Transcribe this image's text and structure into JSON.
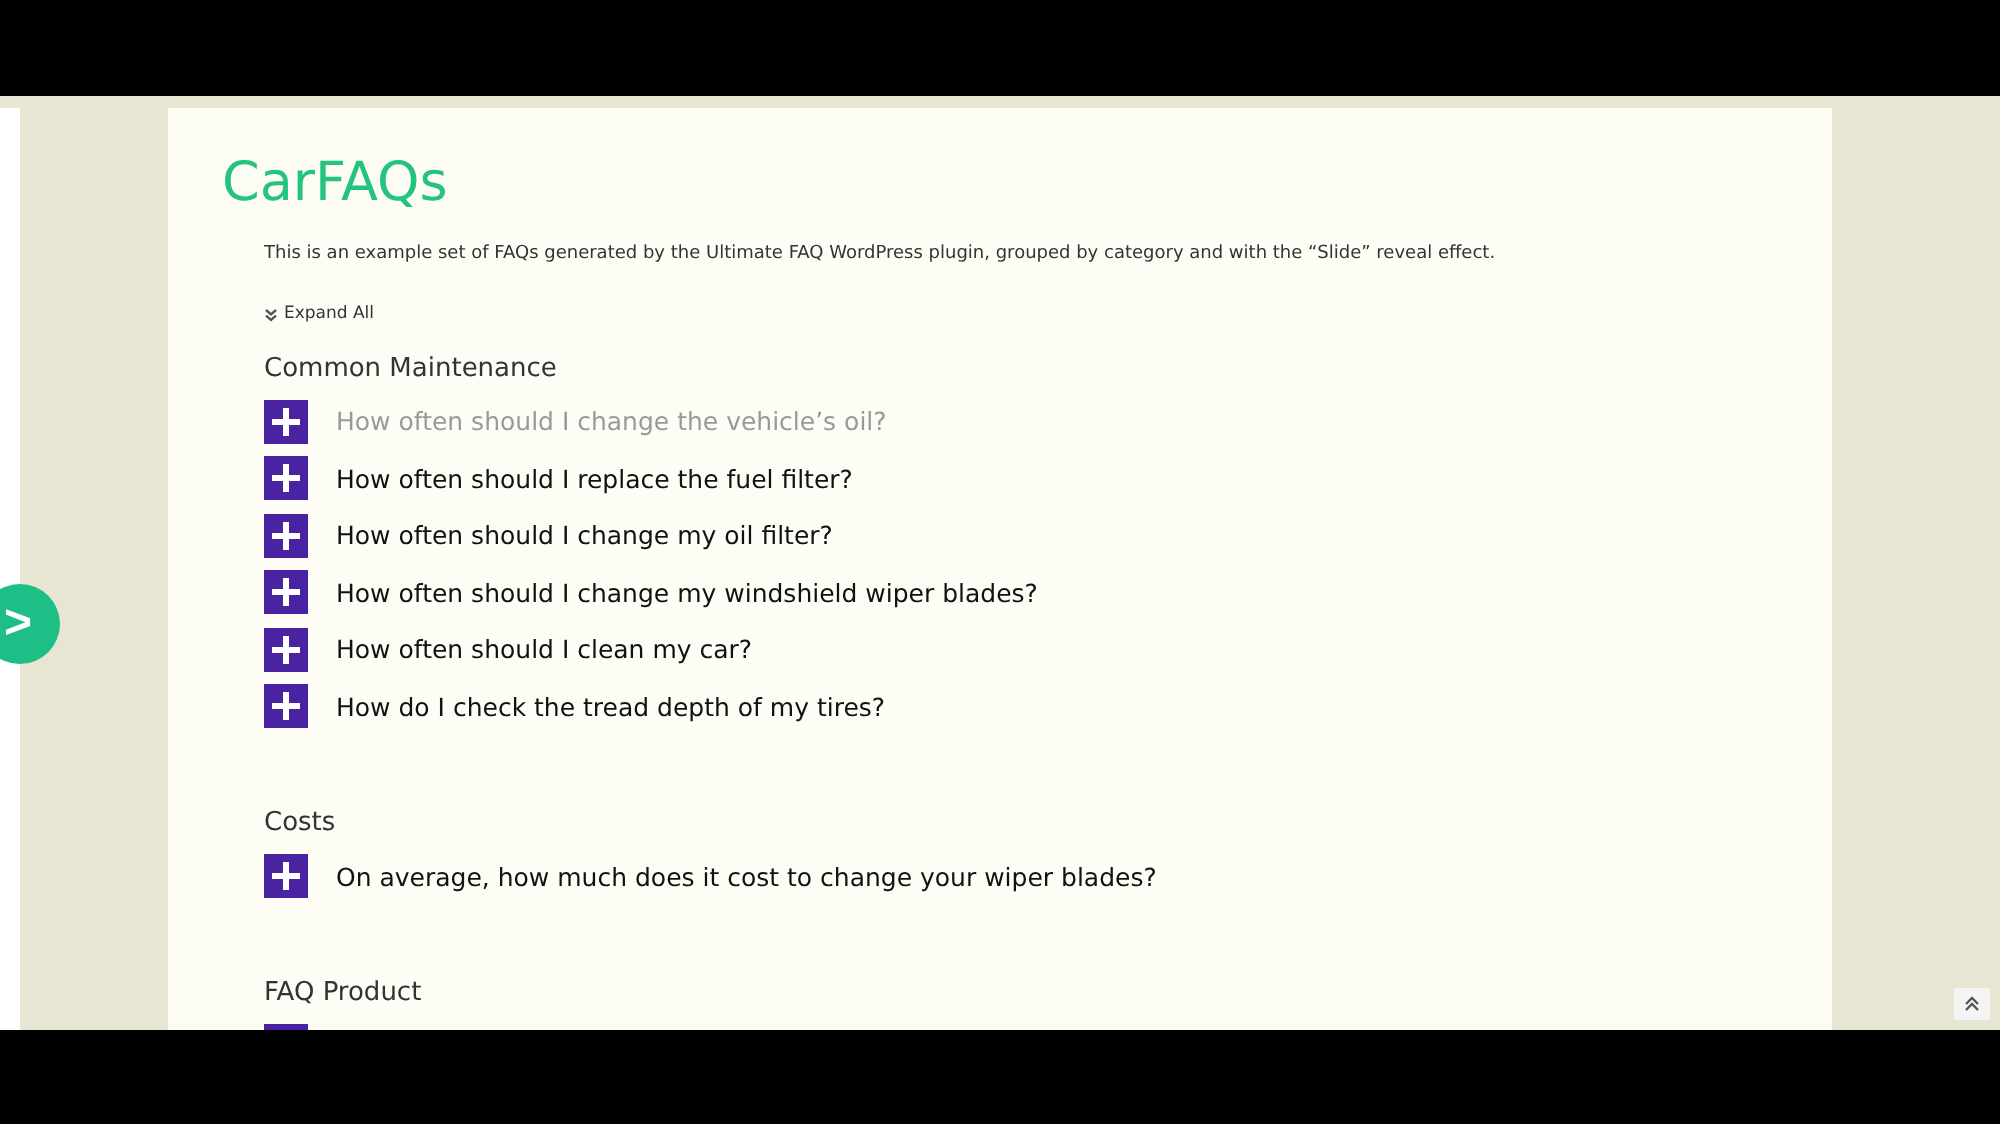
{
  "page_title": "CarFAQs",
  "description": "This is an example set of FAQs generated by the Ultimate FAQ WordPress plugin, grouped by category and with the “Slide” reveal effect.",
  "expand_all": "Expand All",
  "categories": [
    {
      "name": "Common Maintenance",
      "questions": [
        {
          "kind": "question",
          "text": "How often should I change the vehicle’s oil?",
          "hovered": true
        },
        {
          "kind": "question",
          "text": "How often should I replace the fuel filter?",
          "hovered": false
        },
        {
          "kind": "question",
          "text": "How often should I change my oil filter?",
          "hovered": false
        },
        {
          "kind": "question",
          "text": "How often should I change my windshield wiper blades?",
          "hovered": false
        },
        {
          "kind": "question",
          "text": "How often should I clean my car?",
          "hovered": false
        },
        {
          "kind": "question",
          "text": "How do I check the tread depth of my tires?",
          "hovered": false
        }
      ]
    },
    {
      "name": "Costs",
      "questions": [
        {
          "kind": "question",
          "text": "On average, how much does it cost to change your wiper blades?",
          "hovered": false
        }
      ]
    },
    {
      "name": "FAQ Product",
      "questions": [
        {
          "kind": "icon_only"
        }
      ]
    }
  ],
  "side_toggle": ">"
}
